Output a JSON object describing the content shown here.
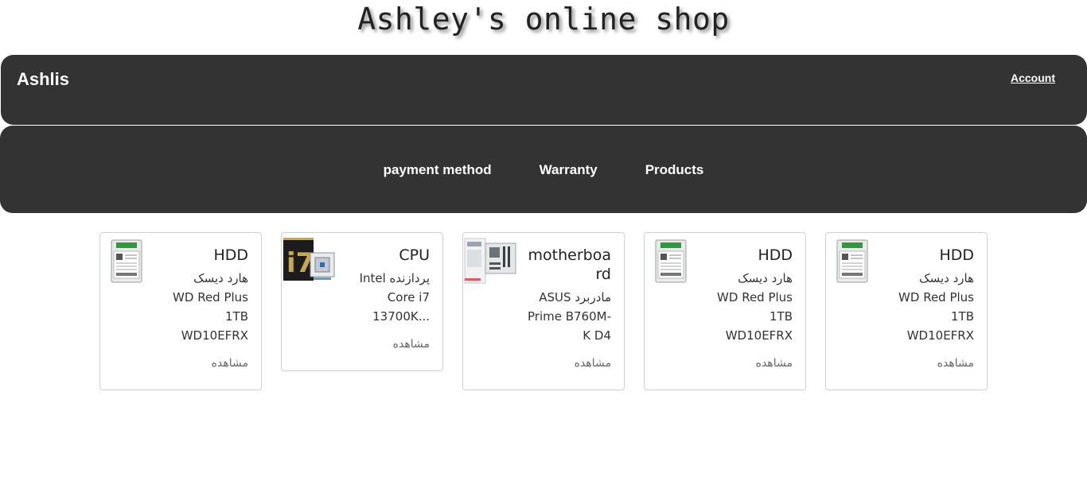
{
  "header": {
    "site_title": "Ashley's online shop"
  },
  "topbar": {
    "brand": "Ashlis",
    "account_link": "Account"
  },
  "nav": {
    "items": [
      "payment method",
      "Warranty",
      "Products"
    ]
  },
  "products": [
    {
      "title": "HDD",
      "desc": [
        "هارد دیسک",
        "WD Red Plus",
        "1TB",
        "WD10EFRX"
      ],
      "view": "مشاهده",
      "image_icon": "hdd-image"
    },
    {
      "title": "CPU",
      "desc": [
        "Intel پردازنده",
        "Core i7",
        "13700K..."
      ],
      "view": "مشاهده",
      "image_icon": "cpu-box-image"
    },
    {
      "title": "motherboard",
      "desc": [
        "ASUS مادربرد",
        "Prime B760M-",
        "K D4"
      ],
      "view": "مشاهده",
      "image_icon": "motherboard-image"
    },
    {
      "title": "HDD",
      "desc": [
        "هارد دیسک",
        "WD Red Plus",
        "1TB",
        "WD10EFRX"
      ],
      "view": "مشاهده",
      "image_icon": "hdd-image"
    },
    {
      "title": "HDD",
      "desc": [
        "هارد دیسک",
        "WD Red Plus",
        "1TB",
        "WD10EFRX"
      ],
      "view": "مشاهده",
      "image_icon": "hdd-image"
    }
  ],
  "colors": {
    "bar_background": "#333333",
    "bar_text": "#ffffff",
    "card_border": "#d0d0d0"
  }
}
